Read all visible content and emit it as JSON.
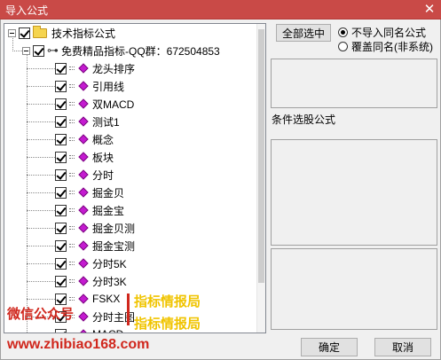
{
  "window": {
    "title": "导入公式",
    "close_glyph": "✕"
  },
  "tree": {
    "root": "技术指标公式",
    "group": "免费精品指标-QQ群：672504853",
    "items": [
      "龙头排序",
      "引用线",
      "双MACD",
      "测试1",
      "概念",
      "板块",
      "分时",
      "掘金贝",
      "掘金宝",
      "掘金贝测",
      "掘金宝测",
      "分时5K",
      "分时3K",
      "FSKX",
      "分时主图",
      "MACD"
    ]
  },
  "buttons": {
    "select_all": "全部选中",
    "ok": "确定",
    "cancel": "取消"
  },
  "options": {
    "no_import": "不导入同名公式",
    "overwrite": "覆盖同名(非系统)",
    "selected": "no_import"
  },
  "right_panel": {
    "label": "条件选股公式"
  },
  "watermark": {
    "wechat": "微信公众号",
    "tag1": "指标情报局",
    "tag2": "指标情报局",
    "url": "www.zhibiao168.com"
  },
  "icons": {
    "folder": "folder-icon",
    "key": "key-icon",
    "formula": "formula-diamond-icon"
  }
}
